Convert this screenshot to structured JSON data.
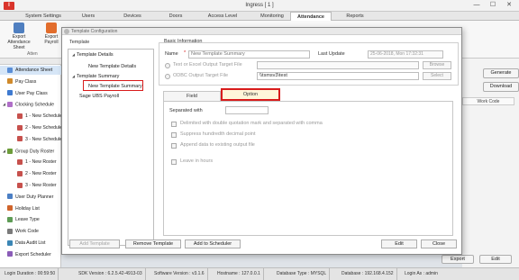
{
  "app": {
    "title": "Ingress [ 1 ]",
    "logo_letter": "I"
  },
  "window_controls": {
    "minimize": "—",
    "maximize": "☐",
    "close": "✕"
  },
  "menu_tabs": [
    "System Settings",
    "Users",
    "Devices",
    "Doors",
    "Access Level",
    "Monitoring",
    "Attendance",
    "Reports"
  ],
  "ribbon": {
    "export_attendance_sheet": "Export Attendance Sheet",
    "export_payroll": "Export Payroll",
    "group_label": "Atten"
  },
  "leftnav": {
    "items": [
      {
        "label": "Attendance Sheet",
        "expander": "",
        "indent": 0,
        "color": "#5a8ed6",
        "selected": true
      },
      {
        "label": "Pay Class",
        "expander": "",
        "indent": 0,
        "color": "#d08a2b",
        "selected": false
      },
      {
        "label": "User Pay Class",
        "expander": "",
        "indent": 0,
        "color": "#3f7ad0",
        "selected": false
      },
      {
        "label": "Clocking Schedule",
        "expander": "◢",
        "indent": 0,
        "color": "#b06fc8",
        "selected": false
      },
      {
        "label": "1 - New Schedule",
        "expander": "",
        "indent": 1,
        "color": "#c7514d",
        "selected": false
      },
      {
        "label": "2 - New Schedule",
        "expander": "",
        "indent": 1,
        "color": "#c7514d",
        "selected": false
      },
      {
        "label": "3 - New Schedule",
        "expander": "",
        "indent": 1,
        "color": "#c7514d",
        "selected": false
      },
      {
        "label": "Group Duty Roster",
        "expander": "◢",
        "indent": 0,
        "color": "#6d9c3a",
        "selected": false
      },
      {
        "label": "1 - New Roster",
        "expander": "",
        "indent": 1,
        "color": "#c7514d",
        "selected": false
      },
      {
        "label": "2 - New Roster",
        "expander": "",
        "indent": 1,
        "color": "#c7514d",
        "selected": false
      },
      {
        "label": "3 - New Roster",
        "expander": "",
        "indent": 1,
        "color": "#c7514d",
        "selected": false
      },
      {
        "label": "User Duty Planner",
        "expander": "",
        "indent": 0,
        "color": "#4b7fc4",
        "selected": false
      },
      {
        "label": "Holiday List",
        "expander": "",
        "indent": 0,
        "color": "#d0642b",
        "selected": false
      },
      {
        "label": "Leave Type",
        "expander": "",
        "indent": 0,
        "color": "#5e9c55",
        "selected": false
      },
      {
        "label": "Work Code",
        "expander": "",
        "indent": 0,
        "color": "#7a7a7a",
        "selected": false
      },
      {
        "label": "Data Audit List",
        "expander": "",
        "indent": 0,
        "color": "#3b86b5",
        "selected": false
      },
      {
        "label": "Export Scheduler",
        "expander": "",
        "indent": 0,
        "color": "#8b5cb8",
        "selected": false
      }
    ]
  },
  "background_panel": {
    "generate": "Generate",
    "download": "Download",
    "work_code_header": "Work Code",
    "export": "Export",
    "edit": "Edit"
  },
  "statusbar": [
    "Login Duration : 00:59:50",
    "SDK Version : 6.2.5.42-4913-03",
    "Software Version : v3.1.6",
    "Hostname : 127.0.0.1",
    "Database Type : MYSQL",
    "Database : 192.168.4.152",
    "Login As : admin"
  ],
  "dialog": {
    "title": "Template Configuration",
    "template_section": "Template",
    "tree": [
      {
        "label": "Template Details",
        "arrow": "◢",
        "level": 0
      },
      {
        "label": "New Template Details",
        "arrow": "",
        "level": 1
      },
      {
        "label": "Template Summary",
        "arrow": "◢",
        "level": 0
      },
      {
        "label": "New Template Summary",
        "arrow": "",
        "level": 1
      },
      {
        "label": "Sage UBS Payroll",
        "arrow": "",
        "level": 0
      }
    ],
    "basic_info": {
      "section": "Basic Information",
      "name_label": "Name",
      "name_value": "New Template Summary",
      "last_update_label": "Last Update",
      "last_update_value": "25-06-2018, Mon 17:32:31",
      "text_excel_label": "Text or Excel Output Target File",
      "browse": "Browse",
      "odbc_label": "ODBC Output Target File",
      "odbc_value": "\\\\tsmsv3\\test",
      "select": "Select"
    },
    "tabs": {
      "field": "Field",
      "option": "Option"
    },
    "option": {
      "separated_with_label": "Separated with",
      "delimited": "Delimited with double quotation mark and separated with comma",
      "suppress": "Suppress hundredth decimal point",
      "append": "Append data to existing output file",
      "leave_hours": "Leave in hours"
    },
    "buttons": {
      "add_template": "Add Template",
      "remove_template": "Remove Template",
      "add_scheduler": "Add to Scheduler",
      "edit": "Edit",
      "close": "Close"
    }
  }
}
